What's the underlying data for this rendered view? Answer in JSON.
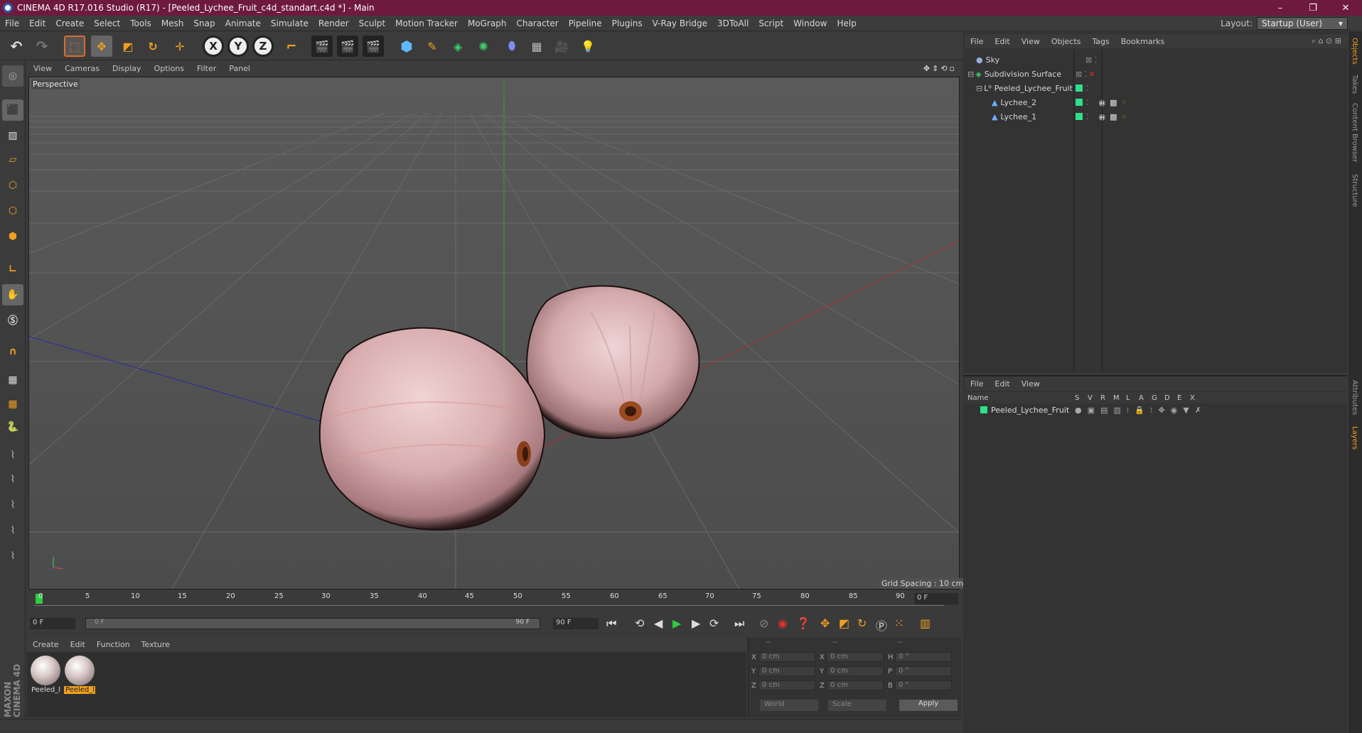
{
  "window": {
    "title": "CINEMA 4D R17.016 Studio (R17) - [Peeled_Lychee_Fruit_c4d_standart.c4d *] - Main",
    "controls": [
      "–",
      "❐",
      "✕"
    ]
  },
  "menu": {
    "items": [
      "File",
      "Edit",
      "Create",
      "Select",
      "Tools",
      "Mesh",
      "Snap",
      "Animate",
      "Simulate",
      "Render",
      "Sculpt",
      "Motion Tracker",
      "MoGraph",
      "Character",
      "Pipeline",
      "Plugins",
      "V-Ray Bridge",
      "3DToAll",
      "Script",
      "Window",
      "Help"
    ],
    "layout_label": "Layout:",
    "layout_value": "Startup (User)"
  },
  "toolbar": {
    "axis_x": "X",
    "axis_y": "Y",
    "axis_z": "Z"
  },
  "viewport": {
    "menu": [
      "View",
      "Cameras",
      "Display",
      "Options",
      "Filter",
      "Panel"
    ],
    "label": "Perspective",
    "grid_spacing": "Grid Spacing : 10 cm"
  },
  "timeline": {
    "ticks": [
      "0",
      "5",
      "10",
      "15",
      "20",
      "25",
      "30",
      "35",
      "40",
      "45",
      "50",
      "55",
      "60",
      "65",
      "70",
      "75",
      "80",
      "85",
      "90"
    ],
    "current_frame": "0 F",
    "start_field": "0 F",
    "range_start": "0 F",
    "range_end": "90 F",
    "end_field": "90 F"
  },
  "materials": {
    "menu": [
      "Create",
      "Edit",
      "Function",
      "Texture"
    ],
    "items": [
      {
        "label": "Peeled_l"
      },
      {
        "label": "Peeled_l"
      }
    ]
  },
  "coords": {
    "headers": [
      "--",
      "--",
      "--"
    ],
    "rows": [
      {
        "a": "X",
        "av": "0 cm",
        "b": "X",
        "bv": "0 cm",
        "c": "H",
        "cv": "0 °"
      },
      {
        "a": "Y",
        "av": "0 cm",
        "b": "Y",
        "bv": "0 cm",
        "c": "P",
        "cv": "0 °"
      },
      {
        "a": "Z",
        "av": "0 cm",
        "b": "Z",
        "bv": "0 cm",
        "c": "B",
        "cv": "0 °"
      }
    ],
    "world": "World",
    "scale": "Scale",
    "apply": "Apply"
  },
  "objects": {
    "menu": [
      "File",
      "Edit",
      "View",
      "Objects",
      "Tags",
      "Bookmarks"
    ],
    "rows": [
      {
        "name": "Sky"
      },
      {
        "name": "Subdivision Surface"
      },
      {
        "name": "Peeled_Lychee_Fruit"
      },
      {
        "name": "Lychee_2"
      },
      {
        "name": "Lychee_1"
      }
    ]
  },
  "layers": {
    "menu": [
      "File",
      "Edit",
      "View"
    ],
    "header_name": "Name",
    "header_cols": [
      "S",
      "V",
      "R",
      "M",
      "L",
      "A",
      "G",
      "D",
      "E",
      "X"
    ],
    "row_name": "Peeled_Lychee_Fruit"
  },
  "dock": [
    "Objects",
    "Takes",
    "Content Browser",
    "Structure",
    "Attributes",
    "Layers"
  ],
  "brand": "MAXON CINEMA 4D",
  "colors": {
    "title_bar": "#6e1a3d",
    "layer_green": "#2ee08a",
    "active_frame": "#2ecc40"
  }
}
